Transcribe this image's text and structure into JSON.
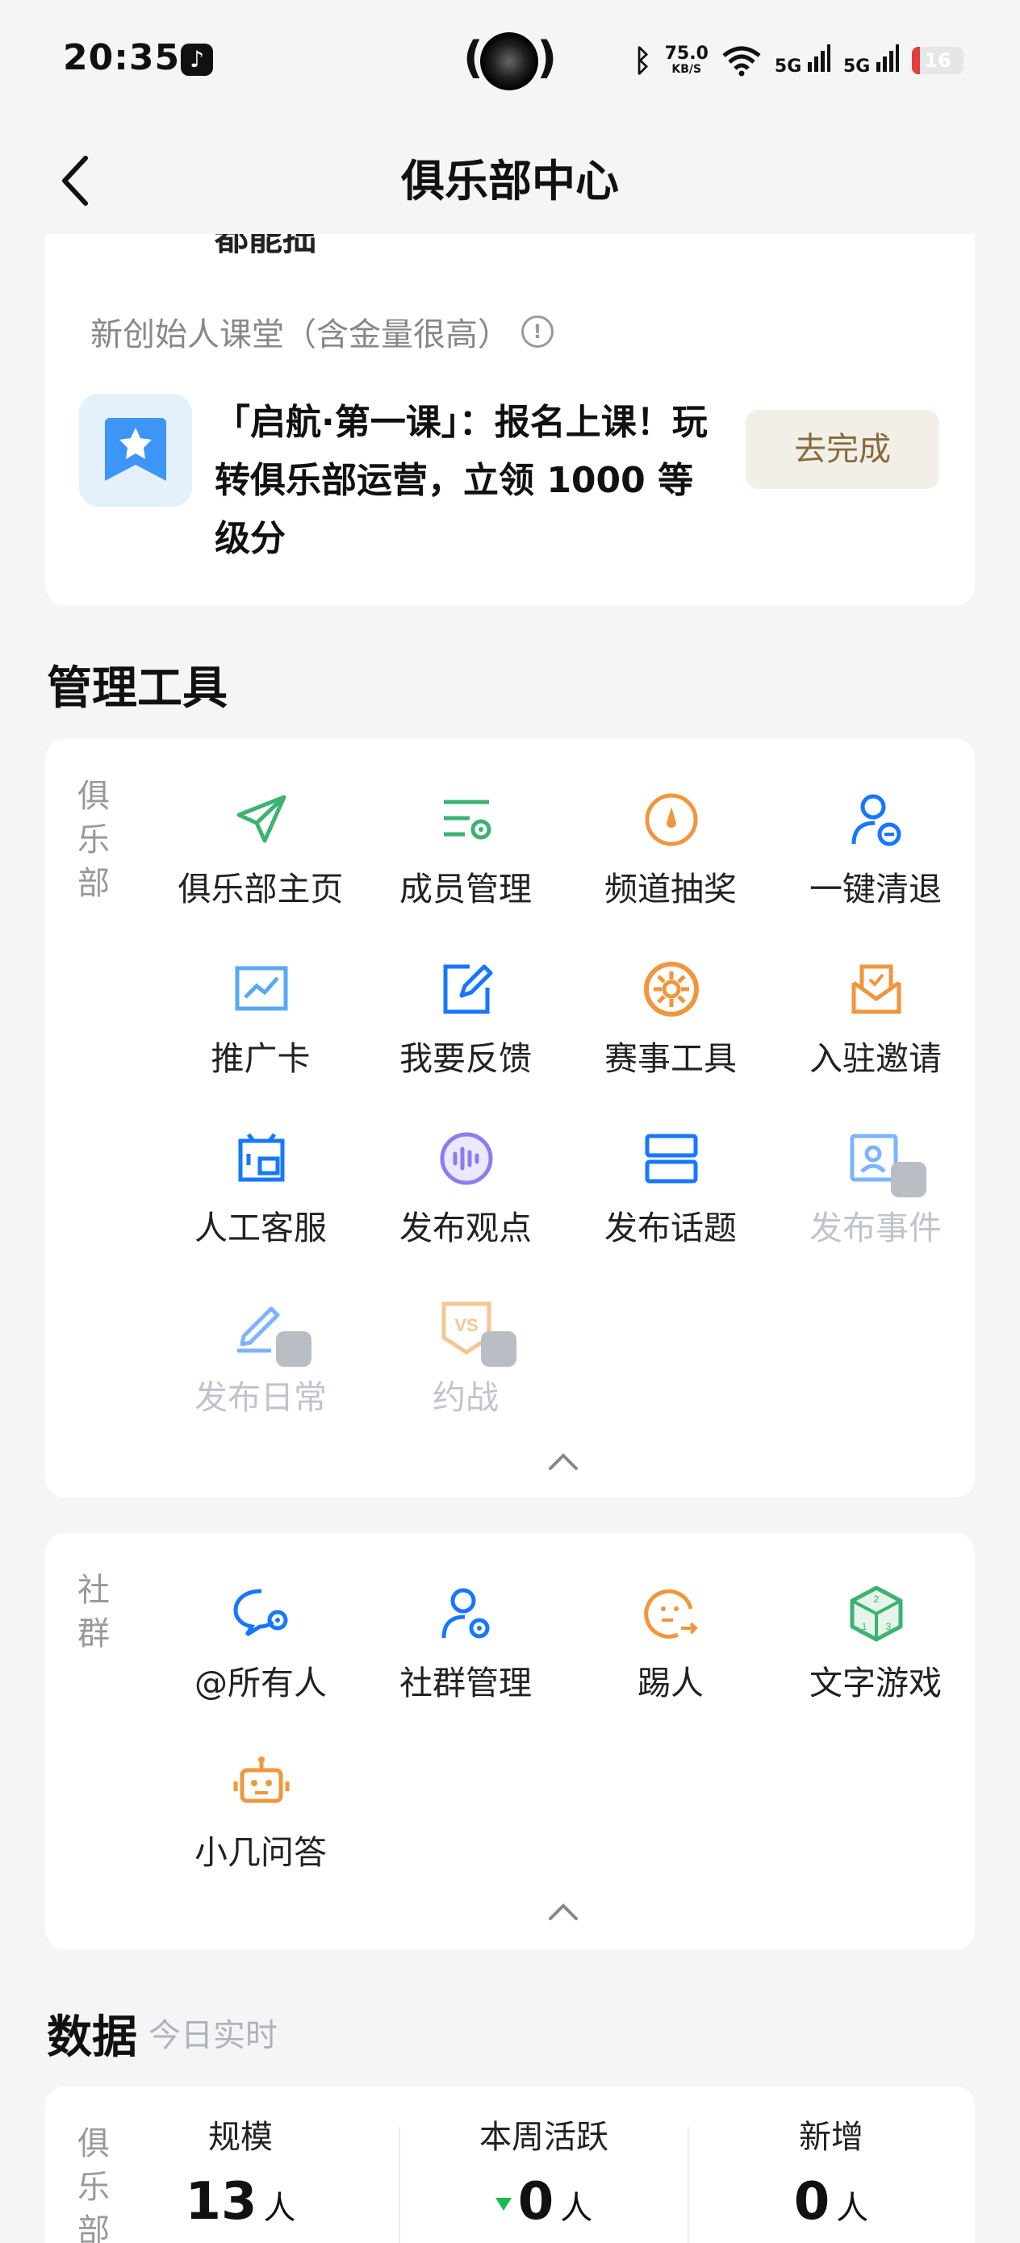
{
  "status_bar": {
    "time": "20:35",
    "app_icon": "tiktok-icon",
    "net_speed_value": "75.0",
    "net_speed_unit": "KB/S",
    "signal1_label": "5G",
    "signal2_label": "5G",
    "battery_level": "16",
    "battery_color": "#e23e3e"
  },
  "nav": {
    "title": "俱乐部中心",
    "back_icon": "chevron-left-icon"
  },
  "course_card": {
    "clipped_text": "都能拙",
    "subtitle": "新创始人课堂（含金量很高）",
    "task_text": "「启航·第一课」：报名上课！玩转俱乐部运营，立领 1000 等级分",
    "button": "去完成"
  },
  "tools": {
    "title": "管理工具",
    "club": {
      "label": "俱乐部",
      "items": [
        {
          "label": "俱乐部主页",
          "icon": "paper-plane-icon",
          "locked": false
        },
        {
          "label": "成员管理",
          "icon": "list-settings-icon",
          "locked": false
        },
        {
          "label": "频道抽奖",
          "icon": "lottery-dial-icon",
          "locked": false
        },
        {
          "label": "一键清退",
          "icon": "user-remove-icon",
          "locked": false
        },
        {
          "label": "推广卡",
          "icon": "trend-chart-icon",
          "locked": false
        },
        {
          "label": "我要反馈",
          "icon": "edit-icon",
          "locked": false
        },
        {
          "label": "赛事工具",
          "icon": "tournament-icon",
          "locked": false
        },
        {
          "label": "入驻邀请",
          "icon": "invite-mail-icon",
          "locked": false
        },
        {
          "label": "人工客服",
          "icon": "customer-service-icon",
          "locked": false
        },
        {
          "label": "发布观点",
          "icon": "voice-icon",
          "locked": false
        },
        {
          "label": "发布话题",
          "icon": "topic-cards-icon",
          "locked": false
        },
        {
          "label": "发布事件",
          "icon": "event-image-icon",
          "locked": true
        },
        {
          "label": "发布日常",
          "icon": "pen-icon",
          "locked": true
        },
        {
          "label": "约战",
          "icon": "vs-icon",
          "locked": true
        }
      ]
    },
    "group": {
      "label": "社群",
      "items": [
        {
          "label": "@所有人",
          "icon": "chat-settings-icon",
          "locked": false
        },
        {
          "label": "社群管理",
          "icon": "user-settings-icon",
          "locked": false
        },
        {
          "label": "踢人",
          "icon": "kick-face-icon",
          "locked": false
        },
        {
          "label": "文字游戏",
          "icon": "dice-icon",
          "locked": false
        },
        {
          "label": "小几问答",
          "icon": "robot-icon",
          "locked": false
        }
      ]
    }
  },
  "data_section": {
    "title": "数据",
    "subtitle": "今日实时",
    "row_label": "俱乐部",
    "stats": [
      {
        "label": "规模",
        "value": "13",
        "unit": "人",
        "trend": ""
      },
      {
        "label": "本周活跃",
        "value": "0",
        "unit": "人",
        "trend": "down"
      },
      {
        "label": "新增",
        "value": "0",
        "unit": "人",
        "trend": ""
      }
    ]
  },
  "colors": {
    "green": "#3cb371",
    "blue": "#1677ff",
    "orange": "#f0963c",
    "purple": "#8c7cf0",
    "gray_locked": "#c0c4cc"
  }
}
